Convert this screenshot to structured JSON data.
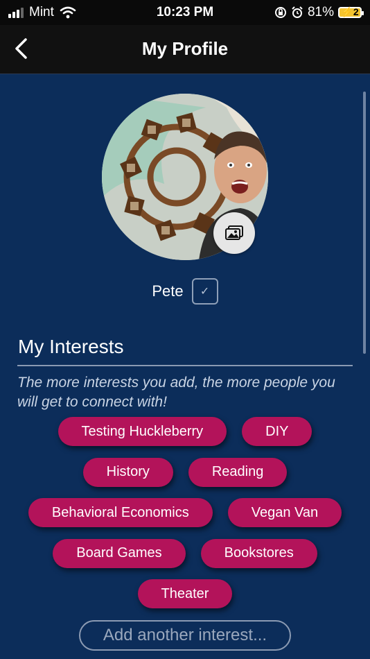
{
  "status_bar": {
    "carrier": "Mint",
    "time": "10:23 PM",
    "battery_percent": "81%",
    "battery_icon_glyph": "⚡2",
    "signal_bars_active": 3,
    "signal_bars_total": 4
  },
  "header": {
    "title": "My Profile",
    "back_icon": "chevron-left-icon"
  },
  "profile": {
    "name": "Pete",
    "photo_button_icon": "image-icon",
    "edit_icon_glyph": "✓"
  },
  "interests": {
    "title": "My Interests",
    "hint": "The more interests you add, the more people you will get to connect with!",
    "rows": [
      [
        "Testing Huckleberry",
        "DIY"
      ],
      [
        "History",
        "Reading"
      ],
      [
        "Behavioral Economics",
        "Vegan Van"
      ],
      [
        "Board Games",
        "Bookstores"
      ],
      [
        "Theater"
      ]
    ],
    "add_placeholder": "Add another interest..."
  },
  "colors": {
    "background": "#0c2d5a",
    "header": "#111111",
    "chip": "#b3135a",
    "battery": "#f4c430"
  }
}
